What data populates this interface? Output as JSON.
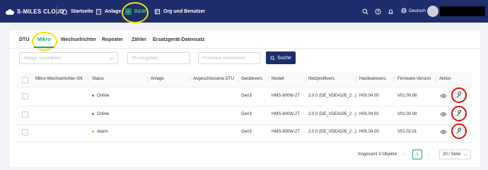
{
  "app": {
    "logo_text": "S-MILES CLOUD"
  },
  "nav": {
    "items": [
      {
        "label": "Startseite",
        "icon": "home-icon"
      },
      {
        "label": "Anlage",
        "icon": "building-icon"
      },
      {
        "label": "B&W",
        "icon": "grid-icon",
        "active": true
      },
      {
        "label": "Org und Benutzer",
        "icon": "org-icon"
      }
    ],
    "language": "Deutsch"
  },
  "tabs": [
    {
      "label": "DTU"
    },
    {
      "label": "Mikro",
      "active": true
    },
    {
      "label": "Wechselrichter"
    },
    {
      "label": "Repeater"
    },
    {
      "label": "Zähler"
    },
    {
      "label": "Ersatzgerät-Datensatz"
    }
  ],
  "filters": {
    "plant_placeholder": "Anlage auswählen",
    "sn_placeholder": "SN eingeben",
    "firmware_placeholder": "Firmware-Versionsnr.",
    "search_label": "Suche"
  },
  "table": {
    "headers": [
      "Mikro-Wechselrichter-SN",
      "Status",
      "Anlage",
      "Angeschlossene DTU",
      "Gerätevers.",
      "Modell",
      "Netzprofilvers.",
      "Hardwarevers.",
      "Firmware-Version",
      "Aktion"
    ],
    "rows": [
      {
        "status": "Online",
        "gen": "Gen3",
        "model": "HMS-800W-2T",
        "grid": "2.0.0 (DE_VDE4105_2 ..)",
        "hw": "H00.04.00",
        "fw": "V01.00.08"
      },
      {
        "status": "Online",
        "gen": "Gen3",
        "model": "HMS-800W-2T",
        "grid": "2.0.0 (DE_VDE4105_2 ..)",
        "hw": "H00.04.00",
        "fw": "V01.00.08"
      },
      {
        "status": "Alarm",
        "gen": "Gen3",
        "model": "HMS-800W-2T",
        "grid": "2.0.0 (DE_VDE4105_2 ..)",
        "hw": "H00.04.00",
        "fw": "V01.02.01"
      }
    ]
  },
  "pagination": {
    "total": "Insgesamt 3 Objekte",
    "current_page": "1",
    "page_size": "20 / Seite"
  },
  "colors": {
    "navbar": "#1e2d6b",
    "accent": "#1aa764",
    "online": "#1aa764",
    "alarm": "#f5a623",
    "highlight_yellow": "#f2e600",
    "highlight_red": "#e01010"
  }
}
